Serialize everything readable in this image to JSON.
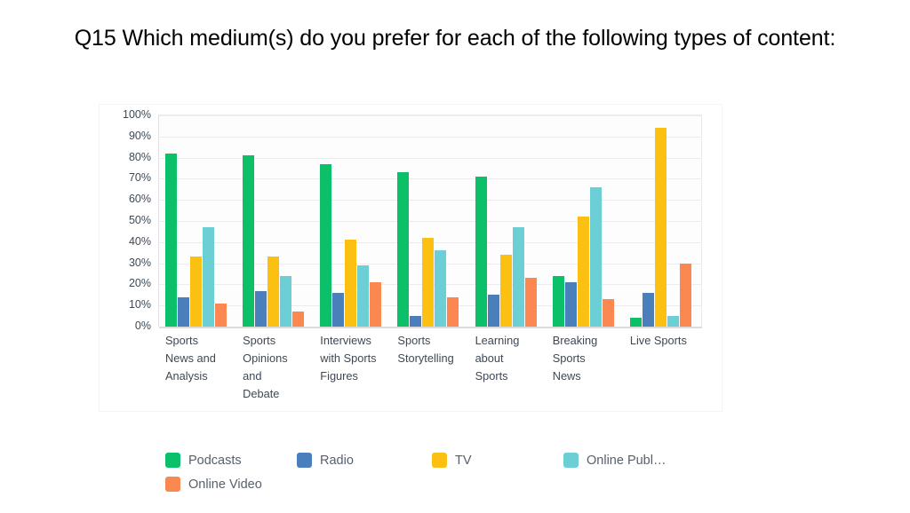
{
  "chart_data": {
    "type": "bar",
    "title": "Q15 Which medium(s) do you prefer for each of the following types of content:",
    "xlabel": "",
    "ylabel": "",
    "ylim": [
      0,
      100
    ],
    "ytick_labels": [
      "100%",
      "90%",
      "80%",
      "70%",
      "60%",
      "50%",
      "40%",
      "30%",
      "20%",
      "10%",
      "0%"
    ],
    "ytick_values": [
      100,
      90,
      80,
      70,
      60,
      50,
      40,
      30,
      20,
      10,
      0
    ],
    "grid": true,
    "legend_position": "bottom-left",
    "categories": [
      "Sports News and Analysis",
      "Sports Opinions and Debate",
      "Interviews with Sports Figures",
      "Sports Storytelling",
      "Learning about Sports",
      "Breaking Sports News",
      "Live Sports"
    ],
    "series": [
      {
        "name": "Podcasts",
        "color": "#0cbf69",
        "values": [
          82,
          81,
          77,
          73,
          71,
          24,
          4
        ]
      },
      {
        "name": "Radio",
        "color": "#4a7fbc",
        "values": [
          14,
          17,
          16,
          5,
          15,
          21,
          16
        ]
      },
      {
        "name": "TV",
        "color": "#fbc011",
        "values": [
          33,
          33,
          41,
          42,
          34,
          52,
          94
        ]
      },
      {
        "name": "Online Publ…",
        "color": "#6dcfd6",
        "values": [
          47,
          24,
          29,
          36,
          47,
          66,
          5
        ]
      },
      {
        "name": "Online Video",
        "color": "#fa8850",
        "values": [
          11,
          7,
          21,
          14,
          23,
          13,
          30
        ]
      }
    ]
  },
  "legend": {
    "items": [
      {
        "label": "Podcasts",
        "color": "#0cbf69"
      },
      {
        "label": "Radio",
        "color": "#4a7fbc"
      },
      {
        "label": "TV",
        "color": "#fbc011"
      },
      {
        "label": "Online Publ…",
        "color": "#6dcfd6"
      },
      {
        "label": "Online Video",
        "color": "#fa8850"
      }
    ]
  }
}
